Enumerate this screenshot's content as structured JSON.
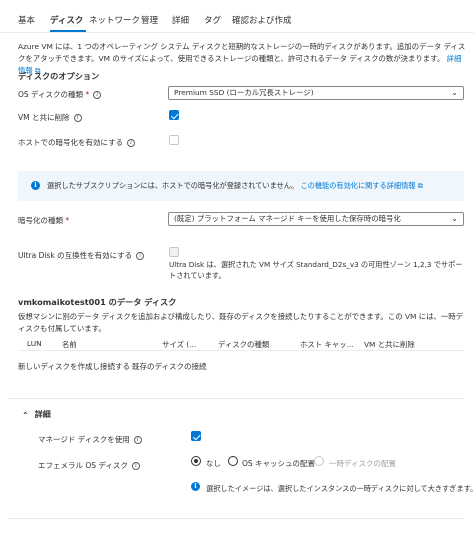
{
  "tabs": [
    {
      "label": "基本",
      "active": false
    },
    {
      "label": "ディスク",
      "active": true
    },
    {
      "label": "ネットワーク",
      "active": false
    },
    {
      "label": "管理",
      "active": false
    },
    {
      "label": "詳細",
      "active": false
    },
    {
      "label": "タグ",
      "active": false
    },
    {
      "label": "確認および作成",
      "active": false
    }
  ],
  "intro": {
    "text": "Azure VM には、1 つのオペレーティング システム ディスクと短期的なストレージの一時的ディスクがあります。追加のデータ ディスクをアタッチできます。VM のサイズによって、使用できるストレージの種類と、許可されるデータ ディスクの数が決まります。",
    "link": "詳細情報"
  },
  "disk_options": {
    "title": "ディスクのオプション",
    "os_disk_type_label": "OS ディスクの種類",
    "os_disk_type_value": "Premium SSD (ローカル冗長ストレージ)",
    "delete_with_vm_label": "VM と共に削除",
    "delete_with_vm_checked": true,
    "host_encryption_label": "ホストでの暗号化を有効にする",
    "host_encryption_checked": false
  },
  "info_banner": {
    "text": "選択したサブスクリプションには、ホストでの暗号化が登録されていません。",
    "link": "この機能の有効化に関する詳細情報"
  },
  "encryption": {
    "label": "暗号化の種類",
    "value": "(既定) プラットフォーム マネージド キーを使用した保存時の暗号化"
  },
  "ultra_disk": {
    "label": "Ultra Disk の互換性を有効にする",
    "checked": false,
    "note": "Ultra Disk は、選択された VM サイズ Standard_D2s_v3 の可用性ゾーン 1,2,3 でサポートされています。"
  },
  "data_disks": {
    "title": "vmkomaikotest001 のデータ ディスク",
    "description": "仮想マシンに別のデータ ディスクを追加および構成したり、既存のディスクを接続したりすることができます。この VM には、一時ディスクも付属しています。",
    "columns": [
      "LUN",
      "名前",
      "サイズ (...",
      "ディスクの種類",
      "ホスト キャッ...",
      "VM と共に削除"
    ],
    "create_link": "新しいディスクを作成し接続する",
    "attach_link": "既存のディスクの接続"
  },
  "advanced": {
    "title": "詳細",
    "managed_disk_label": "マネージド ディスクを使用",
    "managed_disk_checked": true,
    "ephemeral_label": "エフェメラル OS ディスク",
    "ephemeral_options": [
      "なし",
      "OS キャッシュの配置",
      "一時ディスクの配置"
    ],
    "ephemeral_selected": "なし",
    "ephemeral_info": "選択したイメージは、選択したインスタンスの一時ディスクに対して大きすぎます。"
  }
}
